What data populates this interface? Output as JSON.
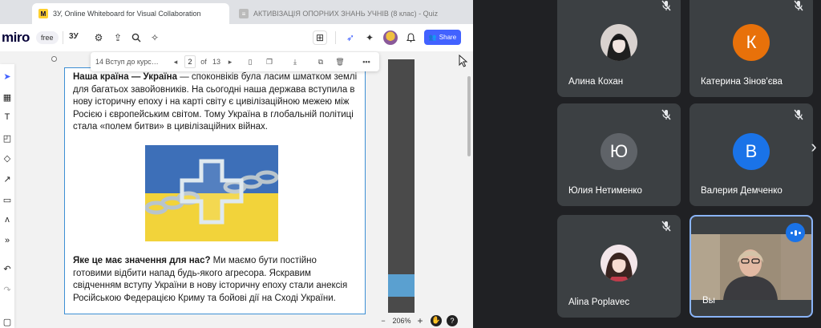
{
  "browser": {
    "tabs": [
      {
        "label": "3У, Online Whiteboard for Visual Collaboration",
        "favicon": "M",
        "active": true
      },
      {
        "label": "АКТИВІЗАЦІЯ ОПОРНИХ ЗНАНЬ УЧНІВ (8 клас) - Quiz",
        "favicon": "≡",
        "active": false
      }
    ]
  },
  "miro": {
    "logo": "miro",
    "plan": "free",
    "board_name": "3У",
    "share_label": "Share",
    "frame_toolbar": {
      "frame_name": "14 Вступ до курс…",
      "page": "2",
      "of": "of",
      "total": "13"
    },
    "zoom": "206%",
    "help": "?"
  },
  "doc": {
    "p1_bold": "Наша країна — Україна",
    "p1_rest": " — споконвіків була ласим шматком земл­і для багатьох завойовників. На сьогодні наша держава вступила в нову історичну епоху і на карті світу є цивілізаційною межею між Росією і європейським світом. Тому Україна в глобальній політиці стала «полем битви» в цивілізаційних війнах.",
    "p2_bold": "Яке це має значення для нас?",
    "p2_rest": " Ми маємо бути постійно готовими відбити напад будь-якого агресора. Яскравим свідченням вступу України в нову історичну епоху стали анексія Російською Федерацією Криму та бойові дії на Сході України."
  },
  "participants": [
    {
      "name": "Алина Кохан",
      "avatar": "photo",
      "muted": true
    },
    {
      "name": "Катерина Зінов'єва",
      "initial": "К",
      "color": "#e8710a",
      "muted": true
    },
    {
      "name": "Юлия Нетименко",
      "initial": "Ю",
      "color": "#5f6368",
      "muted": true
    },
    {
      "name": "Валерия Демченко",
      "initial": "В",
      "color": "#1a73e8",
      "muted": true
    },
    {
      "name": "Alina Poplavec",
      "avatar": "photo",
      "muted": true
    },
    {
      "name": "Вы",
      "video": true,
      "speaking": true
    }
  ],
  "colors": {
    "meet_bg": "#202124",
    "tile_bg": "#3c4043",
    "miro_blue": "#4262ff",
    "frame_border": "#3d8fd4",
    "speaking_blue": "#1a73e8"
  }
}
